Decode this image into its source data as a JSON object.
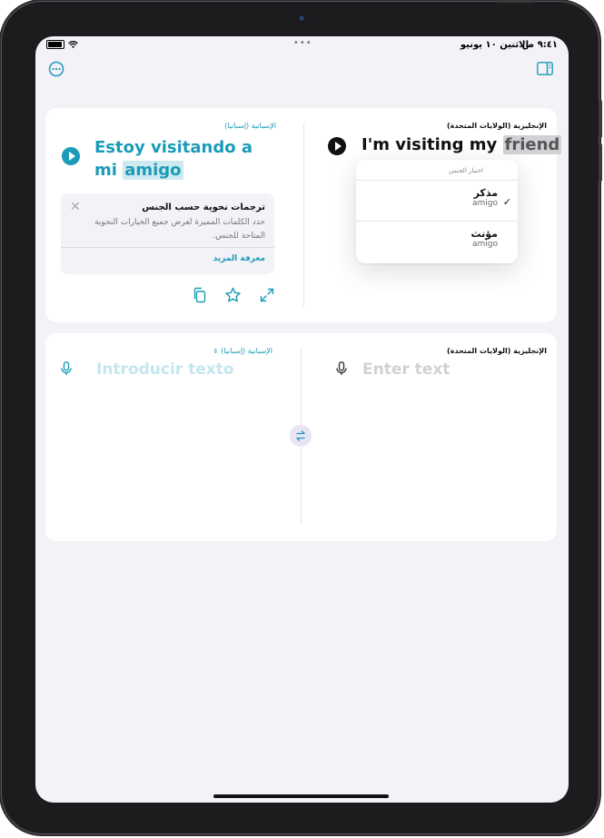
{
  "status_bar": {
    "time": "٩:٤١ ص",
    "date": "الاثنين ١٠ يونيو"
  },
  "toolbar": {
    "more_icon": "ellipsis-circle-icon",
    "sidebar_icon": "sidebar-icon"
  },
  "translation": {
    "target_lang": "الإسبانية (إسبانيا)",
    "target_text_main": "Estoy visitando a mi",
    "target_text_highlight": "amigo",
    "source_lang": "الإنجليزية (الولايات المتحدة)",
    "source_text_main": "I'm visiting my",
    "source_text_highlight": "friend"
  },
  "gender_info": {
    "title": "ترجمات نحوية حسب الجنس",
    "body": "حدد الكلمات المميزة لعرض جميع الخيارات النحوية المتاحة للجنس.",
    "link": "معرفة المزيد"
  },
  "gender_popup": {
    "header": "اختيار الجنس",
    "options": [
      {
        "label": "مذكر",
        "translation": "amigo",
        "selected": true
      },
      {
        "label": "مؤنث",
        "translation": "amigo",
        "selected": false
      }
    ]
  },
  "input": {
    "target_lang": "الإسبانية (إسبانيا)",
    "target_placeholder": "Introducir texto",
    "source_lang": "الإنجليزية (الولايات المتحدة)",
    "source_placeholder": "Enter text"
  },
  "colors": {
    "accent": "#1b9bb8",
    "background": "#f2f2f7"
  }
}
